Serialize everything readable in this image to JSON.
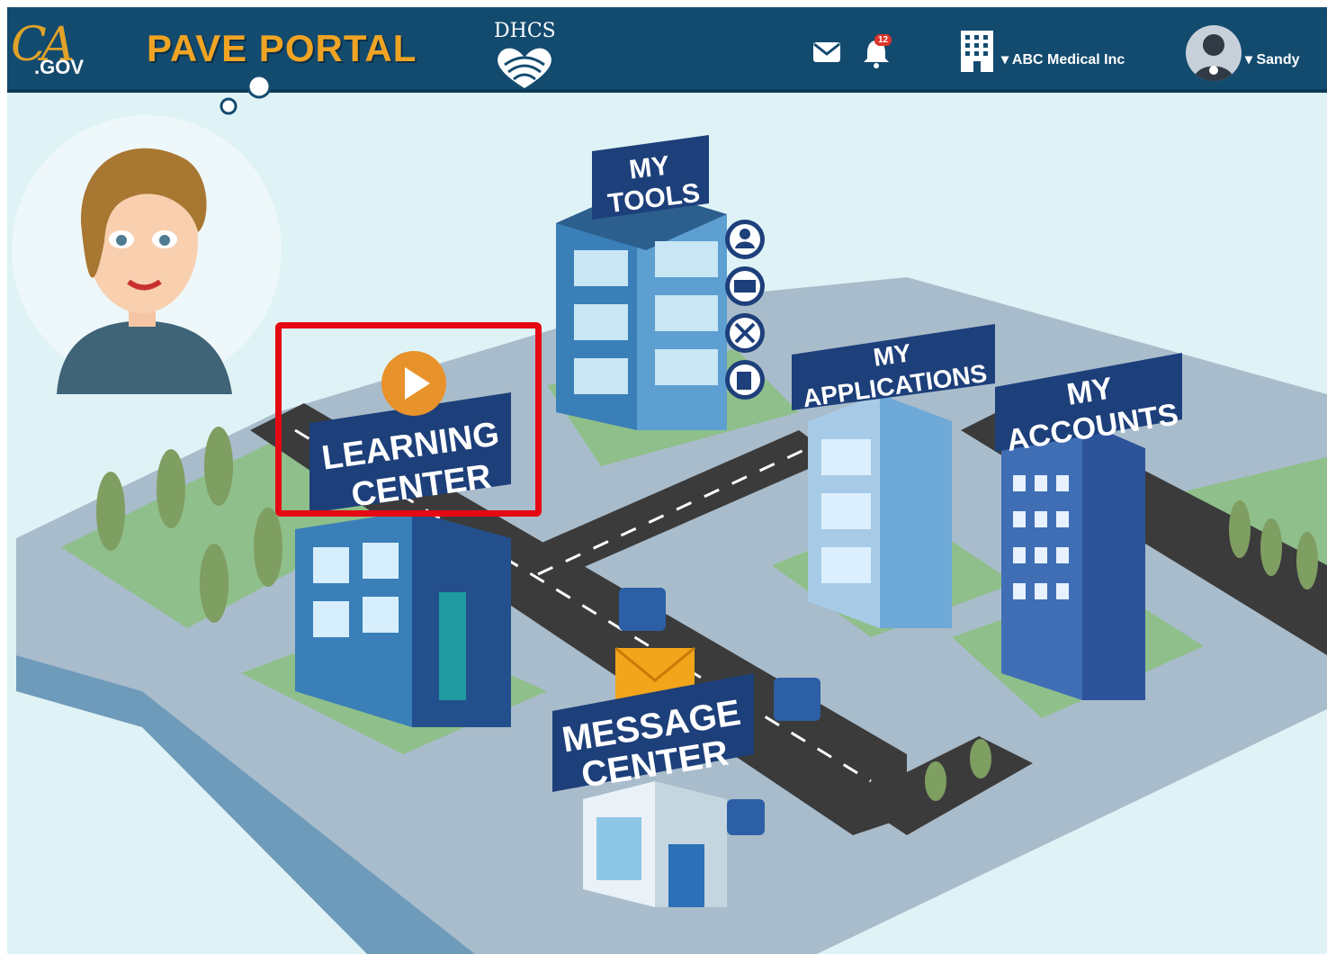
{
  "header": {
    "ca_logo_text": "CA",
    "gov_text": ".GOV",
    "portal_title": "PAVE PORTAL",
    "dhcs_logo_text": "DHCS",
    "notifications": {
      "mail_icon": "mail-icon",
      "bell_icon": "bell-icon",
      "bell_count": "12"
    },
    "org_selector": {
      "icon": "building-icon",
      "caret": "▾",
      "label": "ABC Medical Inc"
    },
    "user_menu": {
      "caret": "▾",
      "label": "Sandy"
    }
  },
  "city": {
    "buildings": [
      {
        "id": "my-tools",
        "line1": "MY",
        "line2": "TOOLS"
      },
      {
        "id": "learning-center",
        "line1": "LEARNING",
        "line2": "CENTER"
      },
      {
        "id": "my-applications",
        "line1": "MY",
        "line2": "APPLICATIONS"
      },
      {
        "id": "my-accounts",
        "line1": "MY",
        "line2": "ACCOUNTS"
      },
      {
        "id": "message-center",
        "line1": "MESSAGE",
        "line2": "CENTER"
      }
    ],
    "tool_icons": [
      "person-icon",
      "book-icon",
      "tools-icon",
      "edit-icon"
    ],
    "learning_center_play_icon": "play-icon"
  },
  "colors": {
    "header_bg": "#134b6f",
    "title_orange": "#f0a423",
    "sign_navy": "#1d3f7a",
    "highlight_red": "#e50914",
    "ground_gray": "#a9bccb",
    "grass_green": "#8fbf8a",
    "road_dark": "#3b3b3b",
    "building_blue": "#3a7fb8"
  }
}
